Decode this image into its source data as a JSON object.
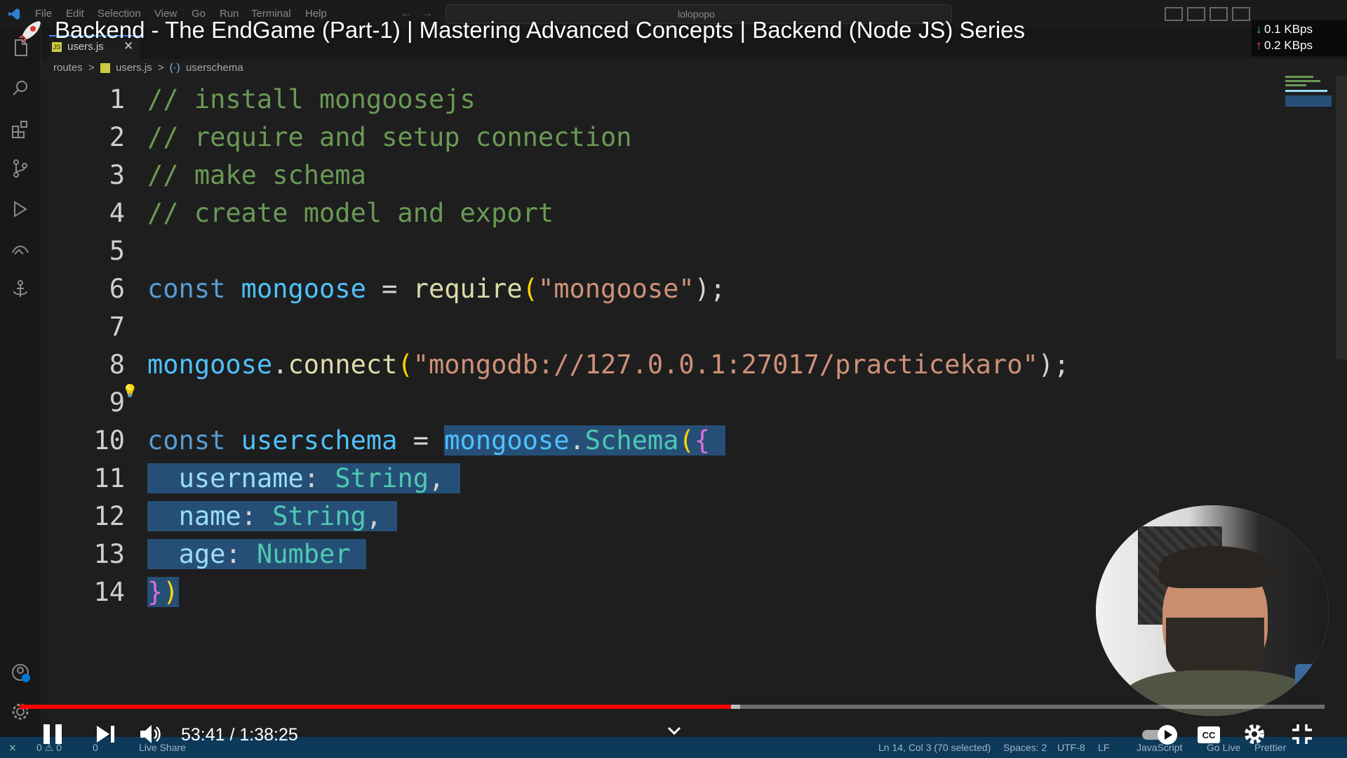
{
  "menu": {
    "items": [
      "File",
      "Edit",
      "Selection",
      "View",
      "Go",
      "Run",
      "Terminal",
      "Help"
    ],
    "search_text": "lolopopo"
  },
  "video": {
    "title": "Backend - The EndGame (Part-1) | Mastering Advanced Concepts | Backend (Node JS) Series",
    "network_down": "0.1 KBps",
    "network_up": "0.2 KBps",
    "time_display": "53:41 / 1:38:25",
    "progress_fraction": 0.545,
    "buffered_fraction": 0.552
  },
  "editor": {
    "tab_label": "users.js",
    "breadcrumb": [
      "routes",
      ">",
      "users.js",
      ">",
      "userschema"
    ],
    "lines": [
      {
        "n": "1"
      },
      {
        "n": "2"
      },
      {
        "n": "3"
      },
      {
        "n": "4"
      },
      {
        "n": "5"
      },
      {
        "n": "6"
      },
      {
        "n": "7"
      },
      {
        "n": "8"
      },
      {
        "n": "9"
      },
      {
        "n": "10"
      },
      {
        "n": "11"
      },
      {
        "n": "12"
      },
      {
        "n": "13"
      },
      {
        "n": "14"
      }
    ],
    "code": {
      "l1": "// install mongoosejs",
      "l2": "// require and setup connection",
      "l3": "// make schema",
      "l4": "// create model and export",
      "l6_kw": "const",
      "l6_var": "mongoose",
      "l6_eq": "=",
      "l6_fn": "require",
      "l6_open": "(",
      "l6_str": "\"mongoose\"",
      "l6_close": ");",
      "l8_obj": "mongoose",
      "l8_dot": ".",
      "l8_fn": "connect",
      "l8_open": "(",
      "l8_str": "\"mongodb://127.0.0.1:27017/practicekaro\"",
      "l8_close": ");",
      "l10_kw": "const",
      "l10_var": "userschema",
      "l10_eq": "=",
      "l10_obj": "mongoose",
      "l10_dot": ".",
      "l10_type": "Schema",
      "l10_open": "(",
      "l10_brace": "{",
      "l11_prop": "username",
      "l11_colon": ":",
      "l11_type": "String",
      "l11_comma": ",",
      "l12_prop": "name",
      "l12_colon": ":",
      "l12_type": "String",
      "l12_comma": ",",
      "l13_prop": "age",
      "l13_colon": ":",
      "l13_type": "Number",
      "l14_brace": "}",
      "l14_paren": ")"
    }
  },
  "statusbar": {
    "problems": "0 ⚠ 0",
    "ports": "0",
    "live_share": "Live Share",
    "position": "Ln 14, Col 3 (70 selected)",
    "spaces": "Spaces: 2",
    "encoding": "UTF-8",
    "eol": "LF",
    "language": "JavaScript",
    "go_live": "Go Live",
    "prettier": "Prettier"
  },
  "colors": {
    "accent": "#3794ff",
    "progress": "#ff0000",
    "selection": "#264f78"
  },
  "icons": [
    "vscode-logo-icon",
    "files-icon",
    "search-icon",
    "extensions-icon",
    "source-control-icon",
    "run-debug-icon",
    "remote-icon",
    "anchor-icon",
    "account-icon",
    "settings-gear-icon",
    "rocket-icon",
    "pause-icon",
    "next-icon",
    "volume-icon",
    "chevron-down-icon",
    "autoplay-toggle-icon",
    "captions-icon",
    "settings-icon",
    "exit-fullscreen-icon"
  ]
}
